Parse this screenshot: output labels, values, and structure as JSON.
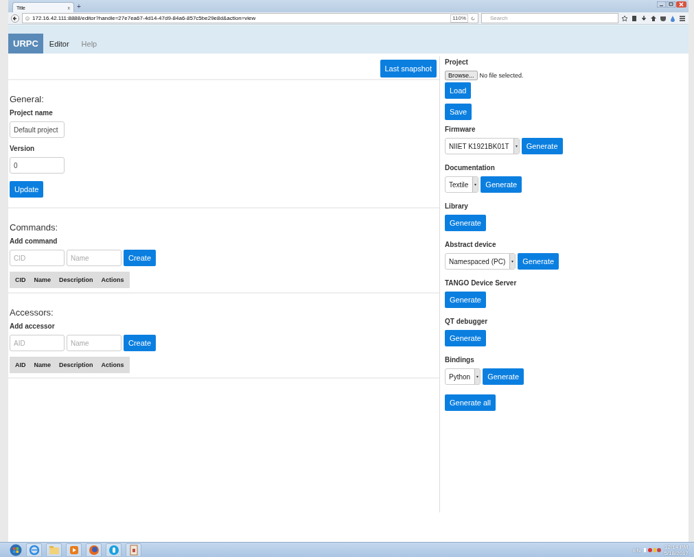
{
  "browser": {
    "tab_title": "Title",
    "tab_close": "x",
    "new_tab": "+",
    "address": "172.16.42.111:8888/editor?handle=27e7ea67-4d14-47d9-84a6-857c5be29e8d&action=view",
    "zoom": "110%",
    "search": {
      "placeholder": "Search"
    }
  },
  "navbar": {
    "brand": "URPC",
    "items": [
      {
        "label": "Editor",
        "selected": true
      },
      {
        "label": "Help",
        "selected": false
      }
    ]
  },
  "editor": {
    "snapshot_button": "Last snapshot",
    "general": {
      "title": "General:",
      "fields": [
        {
          "label": "Project name",
          "value": "Default project"
        },
        {
          "label": "Version",
          "value": "0"
        }
      ],
      "button": "Update"
    },
    "sections": [
      {
        "title": "Commands:",
        "subtitle": "Add command",
        "inputs": [
          {
            "placeholder": "CID"
          },
          {
            "placeholder": "Name"
          }
        ],
        "button": "Create",
        "columns": [
          "CID",
          "Name",
          "Description",
          "Actions"
        ]
      },
      {
        "title": "Accessors:",
        "subtitle": "Add accessor",
        "inputs": [
          {
            "placeholder": "AID"
          },
          {
            "placeholder": "Name"
          }
        ],
        "button": "Create",
        "columns": [
          "AID",
          "Name",
          "Description",
          "Actions"
        ]
      }
    ]
  },
  "tools": {
    "sections": [
      {
        "kind": "file",
        "title": "Project",
        "browse": "Browse...",
        "status": "No file selected.",
        "buttons": [
          "Load",
          "Save"
        ]
      },
      {
        "kind": "select",
        "title": "Firmware",
        "value": "NIIET K1921BK01T",
        "button": "Generate"
      },
      {
        "kind": "select",
        "title": "Documentation",
        "value": "Textile",
        "button": "Generate"
      },
      {
        "kind": "button",
        "title": "Library",
        "button": "Generate"
      },
      {
        "kind": "select",
        "title": "Abstract device",
        "value": "Namespaced (PC)",
        "button": "Generate"
      },
      {
        "kind": "button",
        "title": "TANGO Device Server",
        "button": "Generate"
      },
      {
        "kind": "button",
        "title": "QT debugger",
        "button": "Generate"
      },
      {
        "kind": "select",
        "title": "Bindings",
        "value": "Python",
        "button": "Generate"
      }
    ],
    "generate_all": "Generate all"
  },
  "taskbar": {
    "language": "EN",
    "time": "12:14 PM",
    "date": "5/18/2017"
  }
}
